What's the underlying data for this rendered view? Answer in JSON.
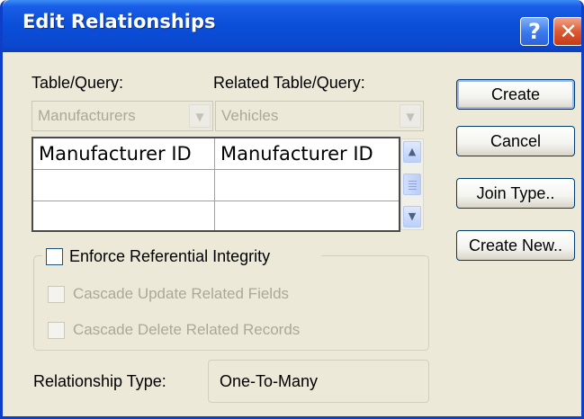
{
  "window": {
    "title": "Edit Relationships",
    "help_glyph": "?",
    "close_glyph": "✕"
  },
  "fields": {
    "table_query_label": "Table/Query:",
    "related_table_query_label": "Related Table/Query:",
    "table_query_value": "Manufacturers",
    "related_table_query_value": "Vehicles"
  },
  "grid": {
    "rows": [
      [
        "Manufacturer ID",
        "Manufacturer ID"
      ],
      [
        "",
        ""
      ],
      [
        "",
        ""
      ]
    ]
  },
  "options": {
    "enforce_label": "Enforce Referential Integrity",
    "cascade_update_label": "Cascade Update Related Fields",
    "cascade_delete_label": "Cascade Delete Related Records"
  },
  "relationship": {
    "label": "Relationship Type:",
    "value": "One-To-Many"
  },
  "buttons": {
    "create": "Create",
    "cancel": "Cancel",
    "join_type": "Join Type..",
    "create_new": "Create New.."
  },
  "colors": {
    "titlebar": "#0a4ed8",
    "dialog_bg": "#ece9d8",
    "close_button": "#dc5a32"
  }
}
